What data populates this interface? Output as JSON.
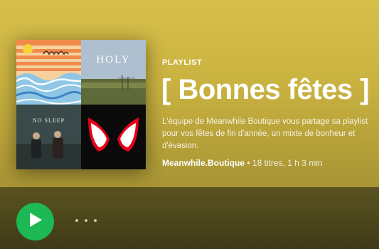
{
  "colors": {
    "hero": "#cdb545",
    "accent_play": "#1db954",
    "background": "#3e3a17"
  },
  "cover": {
    "tiles": [
      {
        "name": "sunset-waves-art",
        "text": ""
      },
      {
        "name": "holy-album-art",
        "text": "HOLY"
      },
      {
        "name": "no-sleep-album-art",
        "text": "NO SLEEP"
      },
      {
        "name": "spider-mask-album-art",
        "text": ""
      }
    ]
  },
  "header": {
    "type_label": "PLAYLIST",
    "title": "[ Bonnes fêtes ]",
    "description": "L'équipe de Meanwhile Boutique vous partage sa playlist pour vos fêtes de fin d'année, un mixte de bonheur et d'évasion.",
    "owner": "Meanwhile.Boutique",
    "separator": " • ",
    "stats": "18 titres, 1 h 3 min"
  },
  "actions": {
    "play_icon": "play-icon",
    "more_icon": "more-options-icon"
  }
}
